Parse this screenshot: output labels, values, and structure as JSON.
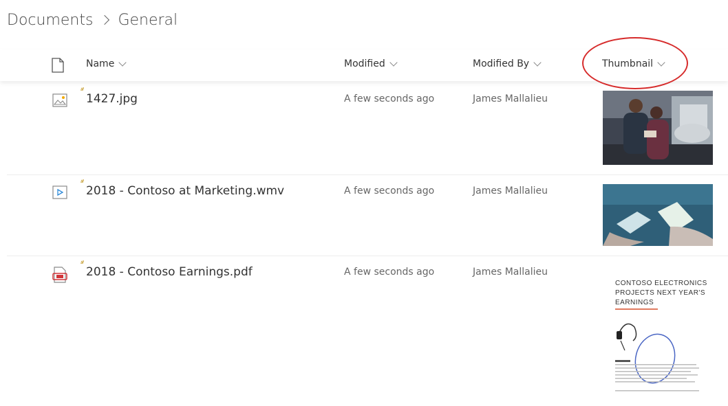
{
  "breadcrumb": {
    "root": "Documents",
    "current": "General"
  },
  "columns": {
    "name": "Name",
    "modified": "Modified",
    "modified_by": "Modified By",
    "thumbnail": "Thumbnail"
  },
  "rows": [
    {
      "name": "1427.jpg",
      "modified": "A few seconds ago",
      "modified_by": "James Mallalieu",
      "type_icon": "image-file-icon"
    },
    {
      "name": "2018 - Contoso at Marketing.wmv",
      "modified": "A few seconds ago",
      "modified_by": "James Mallalieu",
      "type_icon": "video-file-icon"
    },
    {
      "name": "2018 - Contoso Earnings.pdf",
      "modified": "A few seconds ago",
      "modified_by": "James Mallalieu",
      "type_icon": "pdf-file-icon"
    }
  ],
  "pdf_thumbnail": {
    "headline_line1": "CONTOSO ELECTRONICS",
    "headline_line2": "PROJECTS NEXT YEAR'S",
    "headline_line3": "EARNINGS"
  },
  "colors": {
    "highlight_ring": "#d62b2b",
    "new_mark": "#c8a23a",
    "pdf_red": "#d13438",
    "video_blue": "#2b88d8"
  }
}
